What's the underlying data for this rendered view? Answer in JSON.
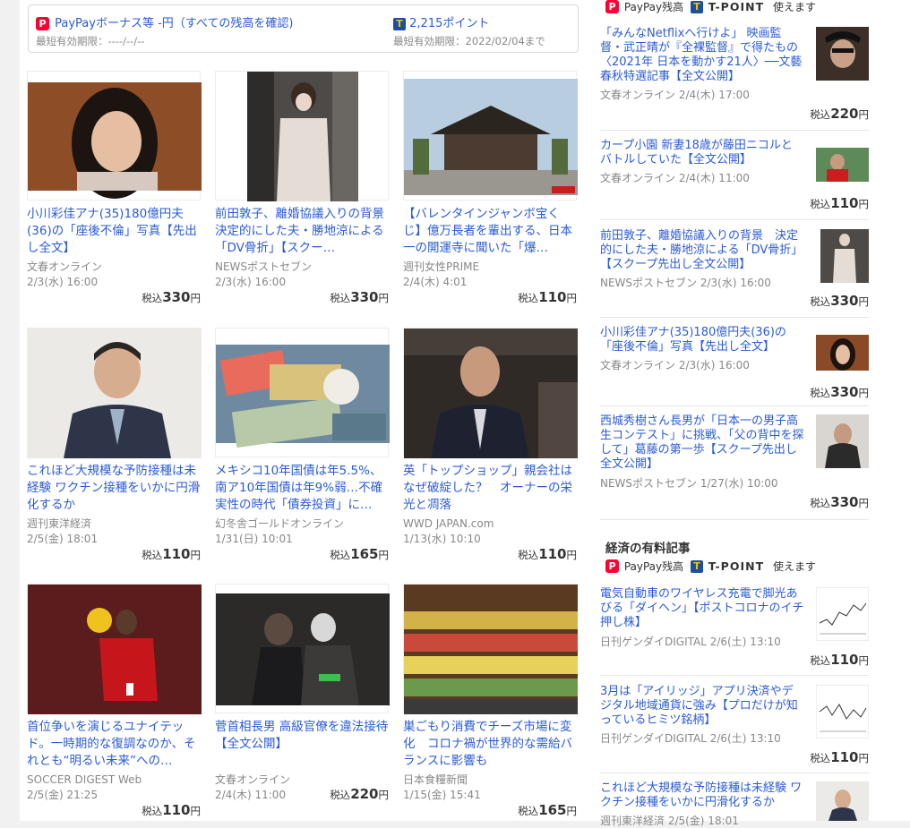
{
  "points": {
    "paypay_label": "PayPayボーナス等 -円（すべての残高を確認)",
    "paypay_expiry": "最短有効期限：----/--/--",
    "tpoint_label": "2,215ポイント",
    "tpoint_expiry": "最短有効期限：2022/02/04まで"
  },
  "price_prefix": "税込",
  "price_suffix": "円",
  "cards": [
    {
      "title": "小川彩佳アナ(35)180億円夫(36)の「座後不倫」写真【先出し全文】",
      "source": "文春オンライン",
      "date": "2/3(水) 16:00",
      "price": "330"
    },
    {
      "title": "前田敦子、離婚協議入りの背景　決定的にした夫・勝地涼による「DV骨折」【スクー…",
      "source": "NEWSポストセブン",
      "date": "2/3(水) 16:00",
      "price": "330"
    },
    {
      "title": "【バレンタインジャンボ宝くじ】億万長者を輩出する、日本一の開運寺に聞いた「爆…",
      "source": "週刊女性PRIME",
      "date": "2/4(木) 4:01",
      "price": "110"
    },
    {
      "title": "これほど大規模な予防接種は未経験 ワクチン接種をいかに円滑化するか",
      "source": "週刊東洋経済",
      "date": "2/5(金) 18:01",
      "price": "110"
    },
    {
      "title": "メキシコ10年国債は年5.5%、南ア10年国債は年9%弱…不確実性の時代「債券投資」に…",
      "source": "幻冬舎ゴールドオンライン",
      "date": "1/31(日) 10:01",
      "price": "165"
    },
    {
      "title": "英「トップショップ」親会社はなぜ破綻した？　オーナーの栄光と凋落",
      "source": "WWD JAPAN.com",
      "date": "1/13(水) 10:10",
      "price": "110"
    },
    {
      "title": "首位争いを演じるユナイテッド。一時期的な復調なのか、それとも“明るい未来”への…",
      "source": "SOCCER DIGEST Web",
      "date": "2/5(金) 21:25",
      "price": "110"
    },
    {
      "title": "菅首相長男 高級官僚を違法接待【全文公開】",
      "source": "文春オンライン",
      "date": "2/4(木) 11:00",
      "price": "220"
    },
    {
      "title": "巣ごもり消費でチーズ市場に変化　コロナ禍が世界的な需給バランスに影響も",
      "source": "日本食糧新聞",
      "date": "1/15(金) 15:41",
      "price": "165"
    }
  ],
  "side_header": {
    "paypay": "PayPay残高",
    "tpoint": "T-POINT",
    "usable": "使えます"
  },
  "side_items": [
    {
      "title": "「みんなNetflixへ行けよ」 映画監督・武正晴が『全裸監督』で得たもの〈2021年 日本を動かす21人〉──文藝春秋特選記事【全文公開】",
      "meta": "文春オンライン 2/4(木) 17:00",
      "price": "220"
    },
    {
      "title": "カープ小園 新妻18歳が藤田ニコルとバトルしていた【全文公開】",
      "meta": "文春オンライン 2/4(木) 11:00",
      "price": "110"
    },
    {
      "title": "前田敦子、離婚協議入りの背景　決定的にした夫・勝地涼による「DV骨折」【スクープ先出し全文公開】",
      "meta": "NEWSポストセブン 2/3(水) 16:00",
      "price": "330"
    },
    {
      "title": "小川彩佳アナ(35)180億円夫(36)の「座後不倫」写真【先出し全文】",
      "meta": "文春オンライン 2/3(水) 16:00",
      "price": "330"
    },
    {
      "title": "西城秀樹さん長男が「日本一の男子高生コンテスト」に挑戦、「父の背中を探して」葛藤の第一歩【スクープ先出し全文公開】",
      "meta": "NEWSポストセブン 1/27(水) 10:00",
      "price": "330"
    }
  ],
  "section_title": "経済の有料記事",
  "econ_items": [
    {
      "title": "電気自動車のワイヤレス充電で脚光あびる「ダイヘン」【ポストコロナのイチ押し株】",
      "meta": "日刊ゲンダイDIGITAL 2/6(土) 13:10",
      "price": "110"
    },
    {
      "title": "3月は「アイリッジ」アプリ決済やデジタル地域通貨に強み【プロだけが知っているヒミツ銘柄】",
      "meta": "日刊ゲンダイDIGITAL 2/6(土) 13:10",
      "price": "110"
    },
    {
      "title": "これほど大規模な予防接種は未経験 ワクチン接種をいかに円滑化するか",
      "meta": "週刊東洋経済 2/5(金) 18:01",
      "price": ""
    }
  ]
}
